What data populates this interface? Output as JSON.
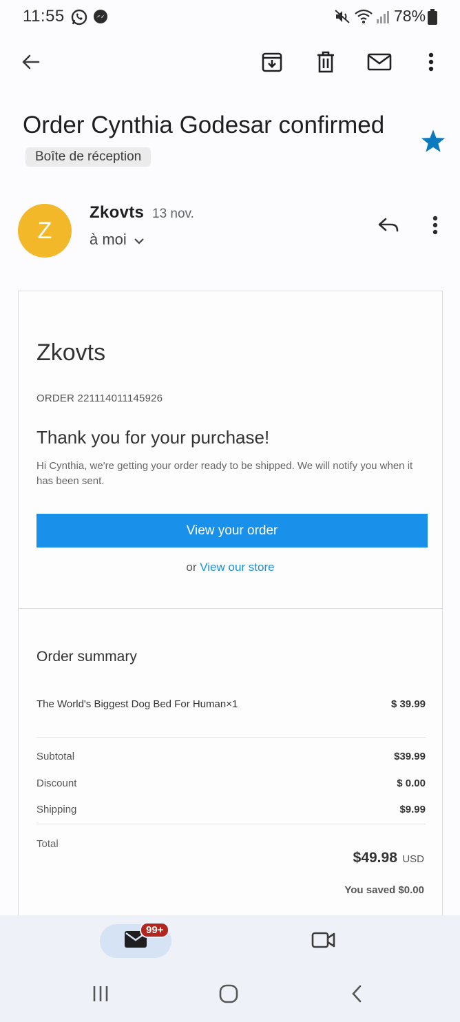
{
  "status_bar": {
    "time": "11:55",
    "battery": "78%",
    "icons": [
      "whatsapp-icon",
      "messenger-icon",
      "mute-icon",
      "wifi-icon",
      "signal-icon",
      "battery-icon"
    ]
  },
  "toolbar": {
    "icons": [
      "back-arrow-icon",
      "archive-icon",
      "delete-icon",
      "mark-unread-icon",
      "more-vert-icon"
    ]
  },
  "email": {
    "subject": "Order Cynthia Godesar confirmed",
    "label": "Boîte de réception",
    "starred": true,
    "star_color": "#0b7bbf",
    "sender": {
      "avatar_letter": "Z",
      "avatar_color": "#f3b72a",
      "name": "Zkovts",
      "date": "13 nov.",
      "recipient": "à moi"
    }
  },
  "message": {
    "store_name": "Zkovts",
    "order_number": "ORDER 221114011145926",
    "heading": "Thank you for your purchase!",
    "body": "Hi Cynthia, we're getting your order ready to be shipped. We will notify you when it has been sent.",
    "primary_button": "View your order",
    "or_text": "or",
    "store_link": "View our store",
    "summary": {
      "title": "Order summary",
      "items": [
        {
          "name": "The World's Biggest Dog Bed For Human×1",
          "price": "$ 39.99"
        }
      ],
      "subtotal_label": "Subtotal",
      "subtotal_value": "$39.99",
      "discount_label": "Discount",
      "discount_value": "$ 0.00",
      "shipping_label": "Shipping",
      "shipping_value": "$9.99",
      "total_label": "Total",
      "total_amount": "$49.98",
      "total_currency": "USD",
      "saved": "You saved $0.00"
    },
    "accent_color": "#1990ea"
  },
  "bottom_nav": {
    "mail_badge": "99+",
    "badge_color": "#b3261e"
  }
}
